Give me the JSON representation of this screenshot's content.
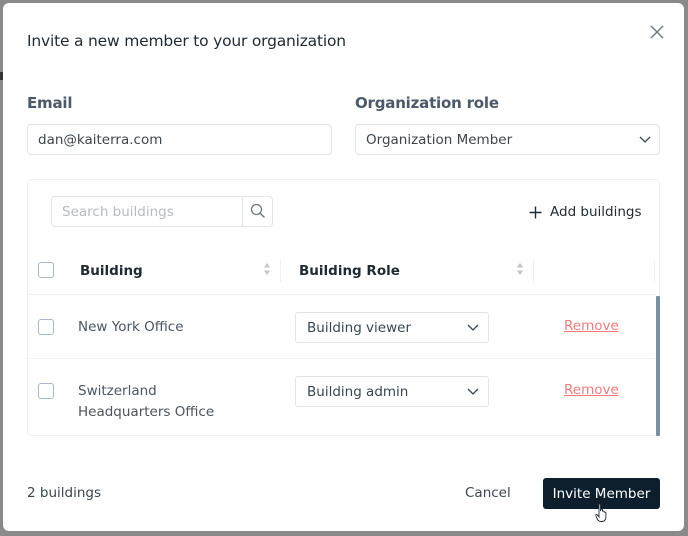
{
  "modal": {
    "title": "Invite a new member to your organization",
    "close_icon": "close-icon"
  },
  "form": {
    "email_label": "Email",
    "email_value": "dan@kaiterra.com",
    "role_label": "Organization role",
    "role_value": "Organization Member"
  },
  "buildings_panel": {
    "search_placeholder": "Search buildings",
    "search_value": "",
    "add_label": "Add buildings",
    "columns": [
      "Building",
      "Building Role"
    ],
    "rows": [
      {
        "name": "New York Office",
        "role": "Building viewer",
        "action": "Remove",
        "checked": false
      },
      {
        "name": "Switzerland Headquarters Office",
        "role": "Building admin",
        "action": "Remove",
        "checked": false
      }
    ]
  },
  "footer": {
    "count": "2 buildings",
    "cancel_label": "Cancel",
    "invite_label": "Invite Member"
  },
  "colors": {
    "primary_button": "#0d1f2d",
    "remove_link": "#f07b7b",
    "scrollbar": "#7a8fa5"
  }
}
